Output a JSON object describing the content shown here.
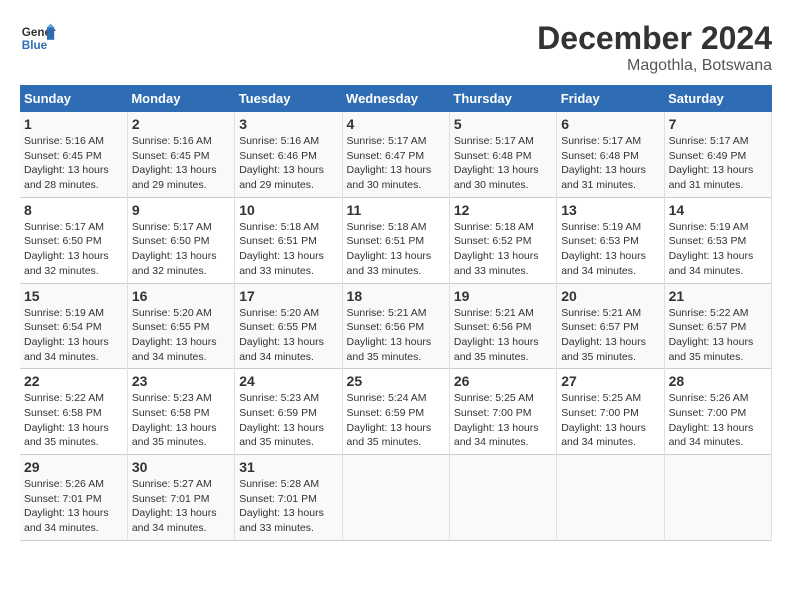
{
  "logo": {
    "line1": "General",
    "line2": "Blue"
  },
  "title": {
    "month_year": "December 2024",
    "location": "Magothla, Botswana"
  },
  "days_of_week": [
    "Sunday",
    "Monday",
    "Tuesday",
    "Wednesday",
    "Thursday",
    "Friday",
    "Saturday"
  ],
  "weeks": [
    [
      {
        "num": "1",
        "sunrise": "5:16 AM",
        "sunset": "6:45 PM",
        "daylight": "13 hours and 28 minutes."
      },
      {
        "num": "2",
        "sunrise": "5:16 AM",
        "sunset": "6:45 PM",
        "daylight": "13 hours and 29 minutes."
      },
      {
        "num": "3",
        "sunrise": "5:16 AM",
        "sunset": "6:46 PM",
        "daylight": "13 hours and 29 minutes."
      },
      {
        "num": "4",
        "sunrise": "5:17 AM",
        "sunset": "6:47 PM",
        "daylight": "13 hours and 30 minutes."
      },
      {
        "num": "5",
        "sunrise": "5:17 AM",
        "sunset": "6:48 PM",
        "daylight": "13 hours and 30 minutes."
      },
      {
        "num": "6",
        "sunrise": "5:17 AM",
        "sunset": "6:48 PM",
        "daylight": "13 hours and 31 minutes."
      },
      {
        "num": "7",
        "sunrise": "5:17 AM",
        "sunset": "6:49 PM",
        "daylight": "13 hours and 31 minutes."
      }
    ],
    [
      {
        "num": "8",
        "sunrise": "5:17 AM",
        "sunset": "6:50 PM",
        "daylight": "13 hours and 32 minutes."
      },
      {
        "num": "9",
        "sunrise": "5:17 AM",
        "sunset": "6:50 PM",
        "daylight": "13 hours and 32 minutes."
      },
      {
        "num": "10",
        "sunrise": "5:18 AM",
        "sunset": "6:51 PM",
        "daylight": "13 hours and 33 minutes."
      },
      {
        "num": "11",
        "sunrise": "5:18 AM",
        "sunset": "6:51 PM",
        "daylight": "13 hours and 33 minutes."
      },
      {
        "num": "12",
        "sunrise": "5:18 AM",
        "sunset": "6:52 PM",
        "daylight": "13 hours and 33 minutes."
      },
      {
        "num": "13",
        "sunrise": "5:19 AM",
        "sunset": "6:53 PM",
        "daylight": "13 hours and 34 minutes."
      },
      {
        "num": "14",
        "sunrise": "5:19 AM",
        "sunset": "6:53 PM",
        "daylight": "13 hours and 34 minutes."
      }
    ],
    [
      {
        "num": "15",
        "sunrise": "5:19 AM",
        "sunset": "6:54 PM",
        "daylight": "13 hours and 34 minutes."
      },
      {
        "num": "16",
        "sunrise": "5:20 AM",
        "sunset": "6:55 PM",
        "daylight": "13 hours and 34 minutes."
      },
      {
        "num": "17",
        "sunrise": "5:20 AM",
        "sunset": "6:55 PM",
        "daylight": "13 hours and 34 minutes."
      },
      {
        "num": "18",
        "sunrise": "5:21 AM",
        "sunset": "6:56 PM",
        "daylight": "13 hours and 35 minutes."
      },
      {
        "num": "19",
        "sunrise": "5:21 AM",
        "sunset": "6:56 PM",
        "daylight": "13 hours and 35 minutes."
      },
      {
        "num": "20",
        "sunrise": "5:21 AM",
        "sunset": "6:57 PM",
        "daylight": "13 hours and 35 minutes."
      },
      {
        "num": "21",
        "sunrise": "5:22 AM",
        "sunset": "6:57 PM",
        "daylight": "13 hours and 35 minutes."
      }
    ],
    [
      {
        "num": "22",
        "sunrise": "5:22 AM",
        "sunset": "6:58 PM",
        "daylight": "13 hours and 35 minutes."
      },
      {
        "num": "23",
        "sunrise": "5:23 AM",
        "sunset": "6:58 PM",
        "daylight": "13 hours and 35 minutes."
      },
      {
        "num": "24",
        "sunrise": "5:23 AM",
        "sunset": "6:59 PM",
        "daylight": "13 hours and 35 minutes."
      },
      {
        "num": "25",
        "sunrise": "5:24 AM",
        "sunset": "6:59 PM",
        "daylight": "13 hours and 35 minutes."
      },
      {
        "num": "26",
        "sunrise": "5:25 AM",
        "sunset": "7:00 PM",
        "daylight": "13 hours and 34 minutes."
      },
      {
        "num": "27",
        "sunrise": "5:25 AM",
        "sunset": "7:00 PM",
        "daylight": "13 hours and 34 minutes."
      },
      {
        "num": "28",
        "sunrise": "5:26 AM",
        "sunset": "7:00 PM",
        "daylight": "13 hours and 34 minutes."
      }
    ],
    [
      {
        "num": "29",
        "sunrise": "5:26 AM",
        "sunset": "7:01 PM",
        "daylight": "13 hours and 34 minutes."
      },
      {
        "num": "30",
        "sunrise": "5:27 AM",
        "sunset": "7:01 PM",
        "daylight": "13 hours and 34 minutes."
      },
      {
        "num": "31",
        "sunrise": "5:28 AM",
        "sunset": "7:01 PM",
        "daylight": "13 hours and 33 minutes."
      },
      null,
      null,
      null,
      null
    ]
  ],
  "labels": {
    "sunrise": "Sunrise:",
    "sunset": "Sunset:",
    "daylight": "Daylight:"
  }
}
